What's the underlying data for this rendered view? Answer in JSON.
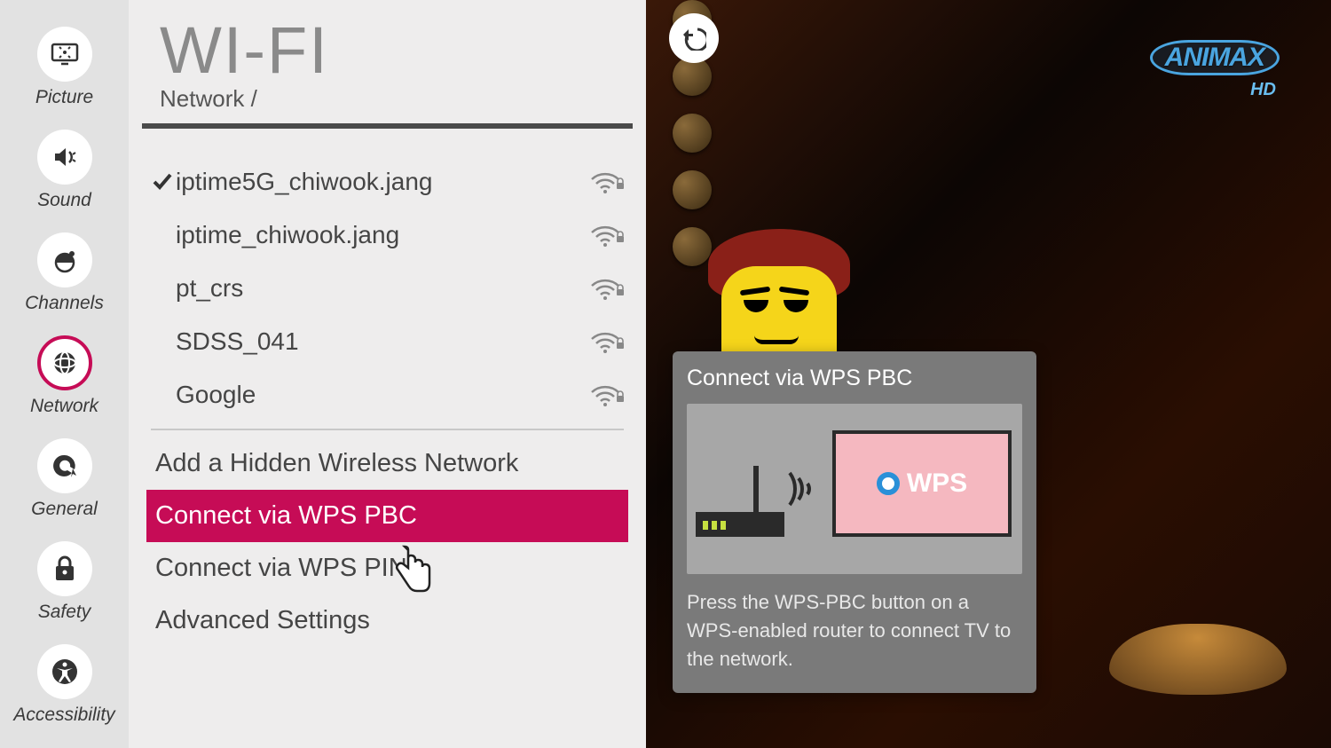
{
  "sidebar": {
    "items": [
      {
        "label": "Picture",
        "icon": "picture"
      },
      {
        "label": "Sound",
        "icon": "sound"
      },
      {
        "label": "Channels",
        "icon": "channels"
      },
      {
        "label": "Network",
        "icon": "network",
        "active": true
      },
      {
        "label": "General",
        "icon": "general"
      },
      {
        "label": "Safety",
        "icon": "safety"
      },
      {
        "label": "Accessibility",
        "icon": "accessibility"
      }
    ]
  },
  "header": {
    "title": "WI-FI",
    "breadcrumb": "Network /"
  },
  "networks": [
    {
      "ssid": "iptime5G_chiwook.jang",
      "connected": true,
      "secured": true
    },
    {
      "ssid": "iptime_chiwook.jang",
      "connected": false,
      "secured": true
    },
    {
      "ssid": "pt_crs",
      "connected": false,
      "secured": true
    },
    {
      "ssid": "SDSS_041",
      "connected": false,
      "secured": true
    },
    {
      "ssid": "Google",
      "connected": false,
      "secured": true
    }
  ],
  "options": {
    "add_hidden": "Add a Hidden Wireless Network",
    "wps_pbc": "Connect via WPS PBC",
    "wps_pin": "Connect via WPS PIN",
    "advanced": "Advanced Settings",
    "selected": "wps_pbc"
  },
  "tooltip": {
    "title": "Connect via WPS PBC",
    "body": "Press the WPS-PBC button on a WPS-enabled router to connect TV to the network.",
    "wps_label": "WPS"
  },
  "preview": {
    "channel_logo": "ANIMAX",
    "channel_quality": "HD"
  },
  "colors": {
    "accent": "#c60c56"
  }
}
